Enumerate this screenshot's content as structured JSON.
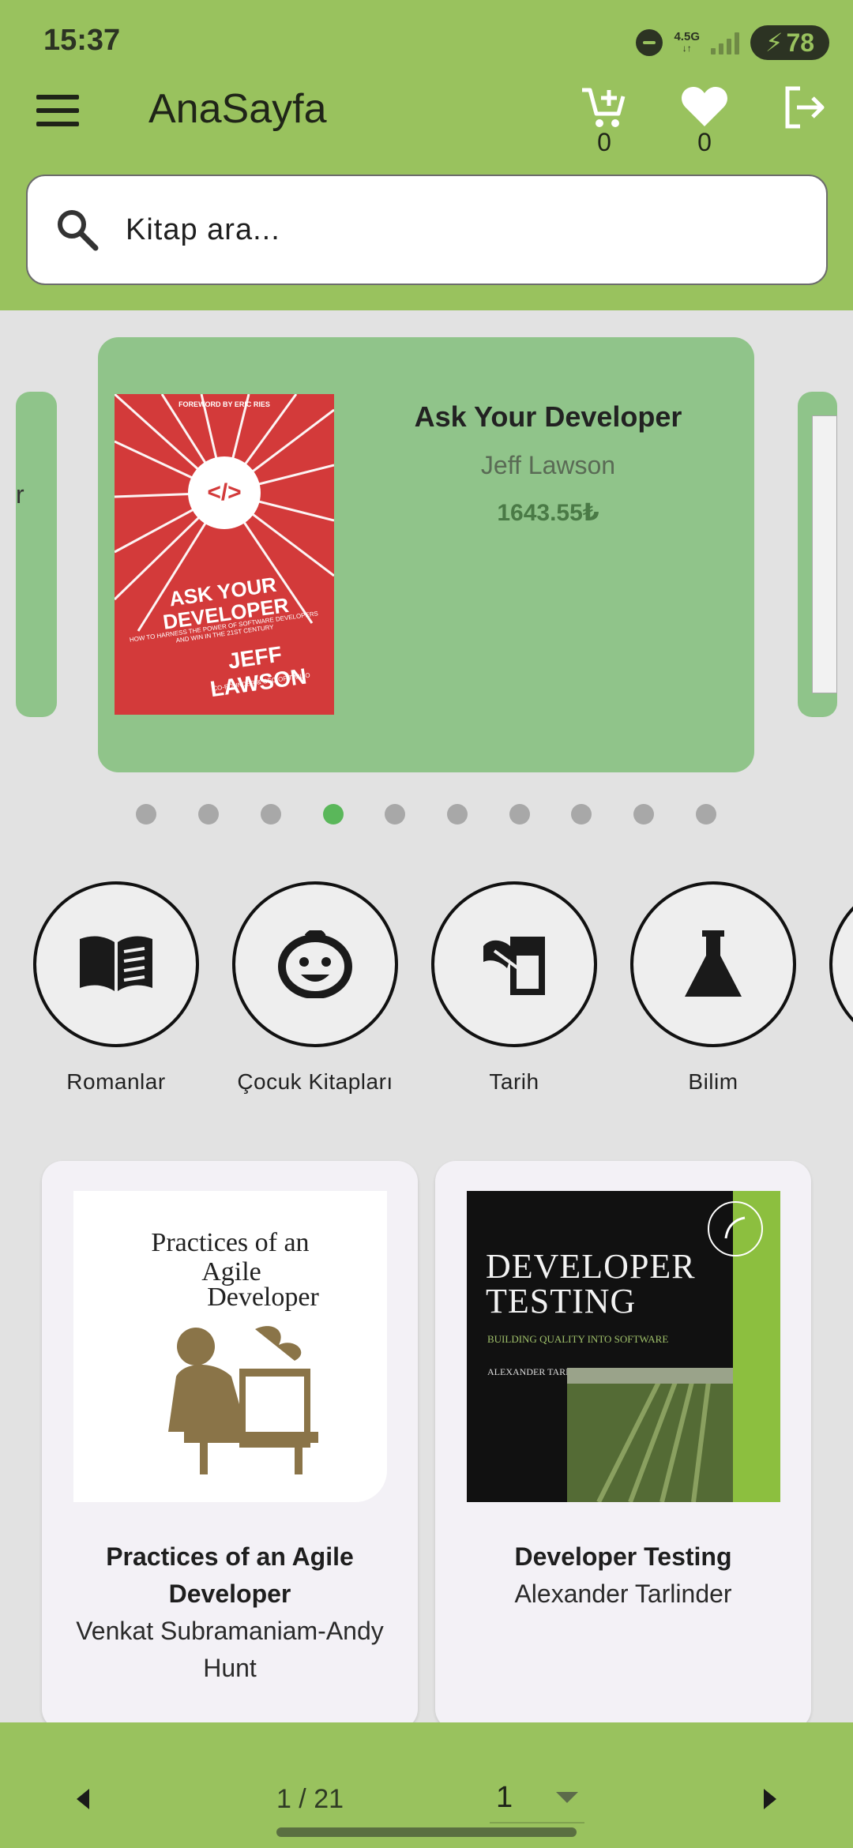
{
  "status_bar": {
    "time": "15:37",
    "network": "4.5G",
    "battery": "78"
  },
  "appbar": {
    "title": "AnaSayfa",
    "cart_count": "0",
    "favorites_count": "0",
    "menu_icon": "hamburger-icon",
    "cart_icon": "add-to-cart-icon",
    "favorite_icon": "heart-icon",
    "logout_icon": "logout-icon"
  },
  "search": {
    "placeholder": "Kitap ara..."
  },
  "carousel": {
    "active_index": 3,
    "total": 10,
    "side_left_text": "r",
    "featured": {
      "title": "Ask Your Developer",
      "author": "Jeff Lawson",
      "price": "1643.55₺",
      "cover": {
        "foreword": "FOREWORD BY ERIC RIES",
        "code": "</>",
        "title_line1": "ASK YOUR DEVELOPER",
        "subtitle": "HOW TO HARNESS THE POWER OF SOFTWARE DEVELOPERS AND WIN IN THE 21ST CENTURY",
        "author": "JEFF LAWSON",
        "author_role": "CO-FOUNDER & CEO OF TWILIO"
      }
    }
  },
  "categories": [
    {
      "label": "Romanlar",
      "icon": "open-book-icon"
    },
    {
      "label": "Çocuk Kitapları",
      "icon": "child-face-icon"
    },
    {
      "label": "Tarih",
      "icon": "history-scroll-icon"
    },
    {
      "label": "Bilim",
      "icon": "flask-icon"
    }
  ],
  "products": [
    {
      "title": "Practices of an Agile Developer",
      "author": "Venkat Subramaniam-Andy Hunt",
      "cover": {
        "line1": "Practices of an",
        "line2": "Agile",
        "line3": "Developer"
      }
    },
    {
      "title": "Developer Testing",
      "author": "Alexander Tarlinder",
      "cover": {
        "line1": "Developer",
        "line2": "Testing",
        "subtitle": "Building Quality into Software",
        "author": "Alexander Tarlinder"
      }
    }
  ],
  "pagination": {
    "info": "1 / 21",
    "selected_page": "1"
  },
  "colors": {
    "header_green": "#99c25e",
    "card_green": "#90c48a",
    "active_dot": "#5ab75a",
    "price_green": "#4a7a46"
  }
}
